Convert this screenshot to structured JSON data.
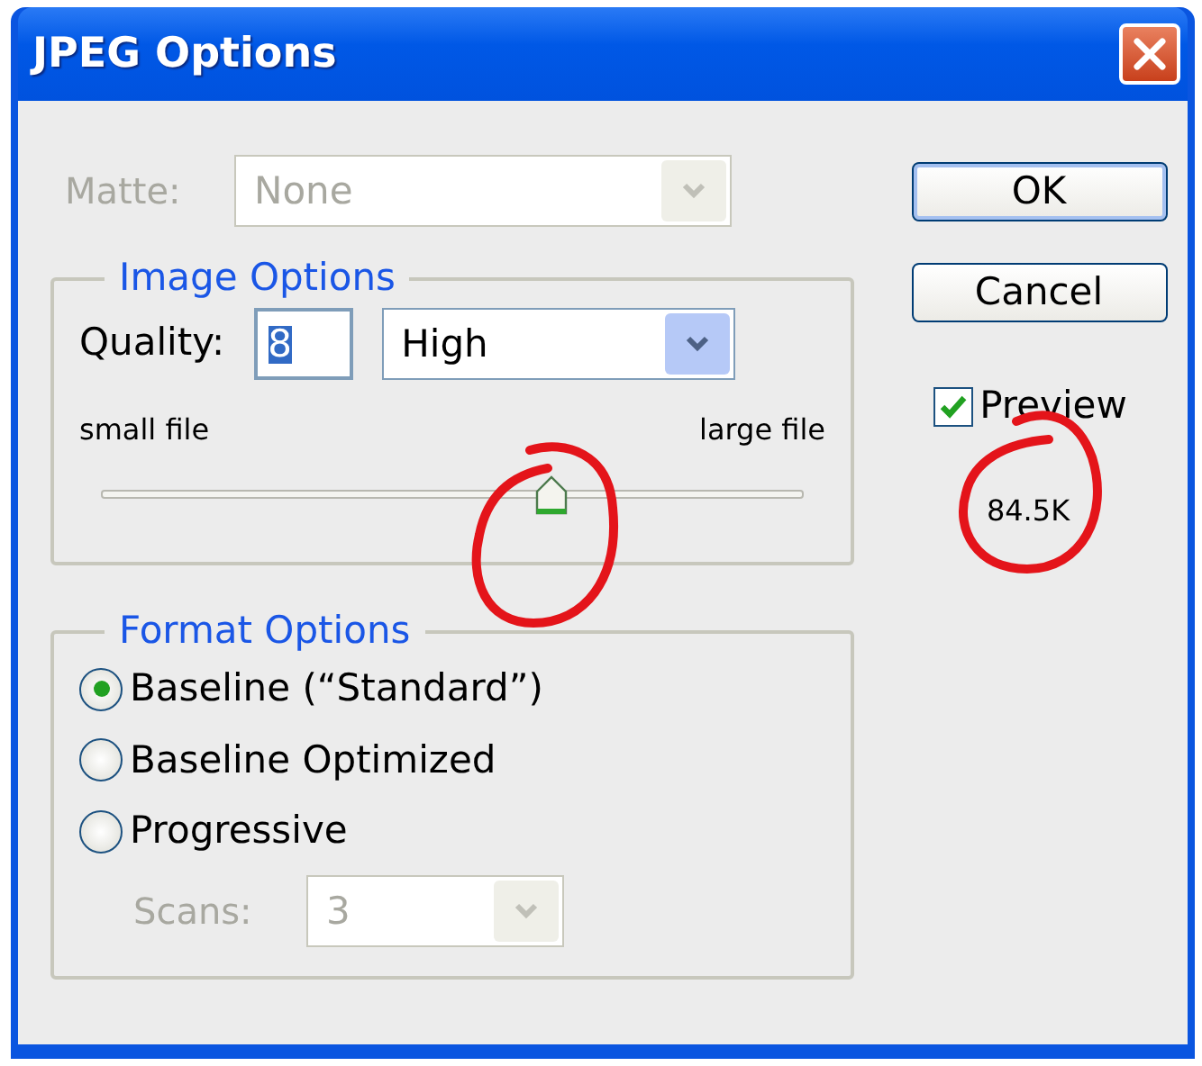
{
  "window": {
    "title": "JPEG Options"
  },
  "matte": {
    "label": "Matte:",
    "value": "None",
    "disabled": true
  },
  "image_options": {
    "title": "Image Options",
    "quality_label": "Quality:",
    "quality_value": "8",
    "quality_value_selected": true,
    "quality_preset": "High",
    "slider_min_label": "small file",
    "slider_max_label": "large file",
    "level": 0.64
  },
  "format_options": {
    "title": "Format Options",
    "choices": [
      {
        "label": "Baseline (“Standard”)",
        "selected": true
      },
      {
        "label": "Baseline Optimized",
        "selected": false
      },
      {
        "label": "Progressive",
        "selected": false
      }
    ],
    "scans": {
      "label": "Scans:",
      "value": "3",
      "disabled": true
    }
  },
  "buttons": [
    {
      "label": "OK",
      "default": true
    },
    {
      "label": "Cancel",
      "default": false
    }
  ],
  "preview": {
    "label": "Preview",
    "checked": true
  },
  "file_size": "84.5K"
}
